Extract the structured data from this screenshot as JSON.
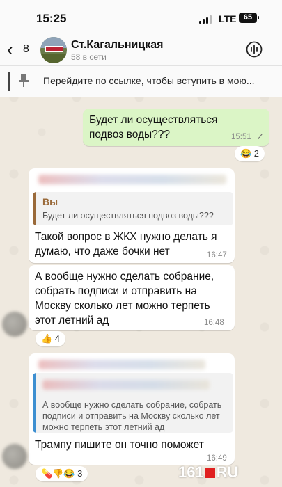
{
  "status_bar": {
    "time": "15:25",
    "network": "LTE",
    "battery": "65"
  },
  "header": {
    "back_count": "8",
    "title": "Ст.Кагальницкая",
    "subtitle": "58 в сети",
    "back_icon": "chevron-left-icon",
    "call_icon": "voice-chat-icon"
  },
  "pinned": {
    "text": "Перейдите по ссылке, чтобы вступить в мою..."
  },
  "messages": [
    {
      "direction": "out",
      "text": "Будет ли осуществляться подвоз воды???",
      "time": "15:51",
      "reaction": "😂 2"
    },
    {
      "direction": "in",
      "quote_sender": "Вы",
      "quote_text": "Будет ли осуществляться подвоз воды???",
      "text": "Такой вопрос в ЖКХ нужно делать я думаю, что даже бочки нет",
      "time": "16:47"
    },
    {
      "direction": "in",
      "text": "А вообще нужно сделать собрание, собрать подписи и отправить на Москву сколько лет можно терпеть этот летний ад",
      "time": "16:48",
      "reaction": "👍 4"
    },
    {
      "direction": "in",
      "quote_text": "А вообще нужно сделать собрание, собрать подписи и отправить на Москву сколько лет можно терпеть этот летний ад",
      "text": "Трампу пишите он точно поможет",
      "time": "16:49",
      "reaction": "💊👎😂 3"
    }
  ],
  "watermark": {
    "left": "161",
    "right": "RU"
  },
  "colors": {
    "outgoing": "#dbf5c6",
    "incoming": "#ffffff",
    "quote_accent": "#9a6a3a",
    "quote_accent_2": "#3d8fd1"
  }
}
